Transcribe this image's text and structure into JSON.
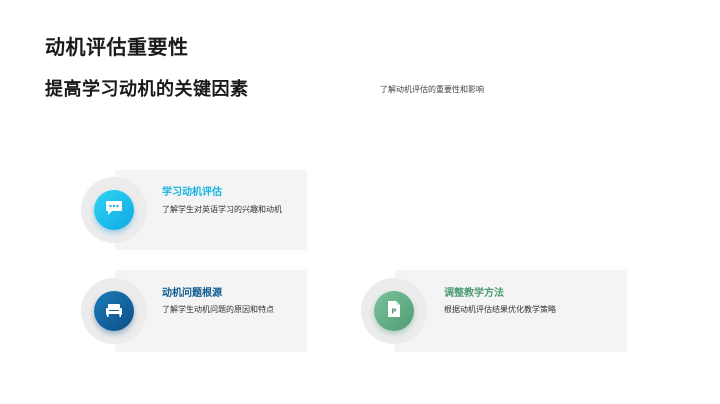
{
  "slide": {
    "title": "动机评估重要性",
    "subtitle": "提高学习动机的关键因素",
    "description": "了解动机评估的重要性和影响"
  },
  "cards": [
    {
      "title": "学习动机评估",
      "text": "了解学生对英语学习的兴趣和动机",
      "icon": "chat-bubble-icon",
      "title_color": "#18b4e0"
    },
    {
      "title": "动机问题根源",
      "text": "了解学生动机问题的原因和特点",
      "icon": "sofa-icon",
      "title_color": "#0f5b8e"
    },
    {
      "title": "调整教学方法",
      "text": "根据动机评估结果优化教学策略",
      "icon": "document-icon",
      "title_color": "#4f9d74"
    }
  ]
}
